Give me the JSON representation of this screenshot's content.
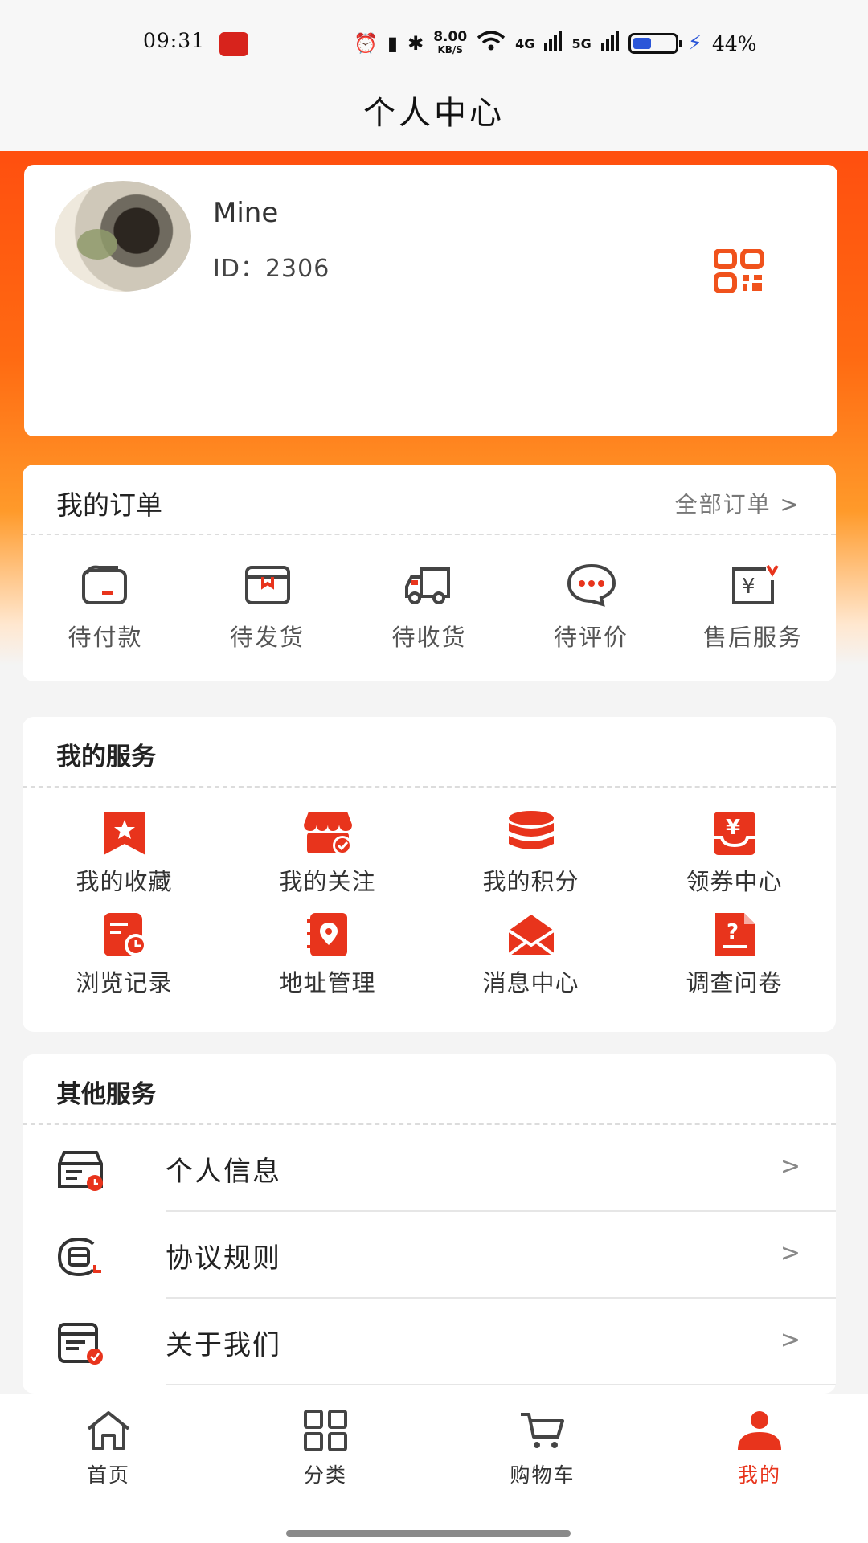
{
  "status_bar": {
    "time": "09:31",
    "speed_value": "8.00",
    "speed_unit": "KB/S",
    "net1": "4G",
    "net2": "5G",
    "battery_percent": "44%",
    "battery_level": 0.44
  },
  "header": {
    "title": "个人中心"
  },
  "profile": {
    "name": "Mine",
    "id_text": "ID：2306"
  },
  "orders": {
    "title": "我的订单",
    "more_label": "全部订单 >",
    "items": [
      {
        "label": "待付款",
        "icon": "wallet-icon"
      },
      {
        "label": "待发货",
        "icon": "box-icon"
      },
      {
        "label": "待收货",
        "icon": "truck-icon"
      },
      {
        "label": "待评价",
        "icon": "chat-icon"
      },
      {
        "label": "售后服务",
        "icon": "refund-icon"
      }
    ]
  },
  "services": {
    "title": "我的服务",
    "items": [
      {
        "label": "我的收藏",
        "icon": "bookmark-star-icon"
      },
      {
        "label": "我的关注",
        "icon": "store-icon"
      },
      {
        "label": "我的积分",
        "icon": "database-icon"
      },
      {
        "label": "领券中心",
        "icon": "coupon-icon"
      },
      {
        "label": "浏览记录",
        "icon": "history-icon"
      },
      {
        "label": "地址管理",
        "icon": "address-book-icon"
      },
      {
        "label": "消息中心",
        "icon": "envelope-icon"
      },
      {
        "label": "调查问卷",
        "icon": "survey-icon"
      }
    ]
  },
  "others": {
    "title": "其他服务",
    "items": [
      {
        "label": "个人信息",
        "icon": "profile-card-icon"
      },
      {
        "label": "协议规则",
        "icon": "agreement-icon"
      },
      {
        "label": "关于我们",
        "icon": "about-icon"
      }
    ],
    "chevron": ">"
  },
  "tabbar": {
    "items": [
      {
        "label": "首页",
        "icon": "home-icon",
        "active": false
      },
      {
        "label": "分类",
        "icon": "grid-icon",
        "active": false
      },
      {
        "label": "购物车",
        "icon": "cart-icon",
        "active": false
      },
      {
        "label": "我的",
        "icon": "user-icon",
        "active": true
      }
    ]
  },
  "colors": {
    "accent": "#e8341c",
    "orange": "#ff5a12",
    "icon_dark": "#333333"
  }
}
